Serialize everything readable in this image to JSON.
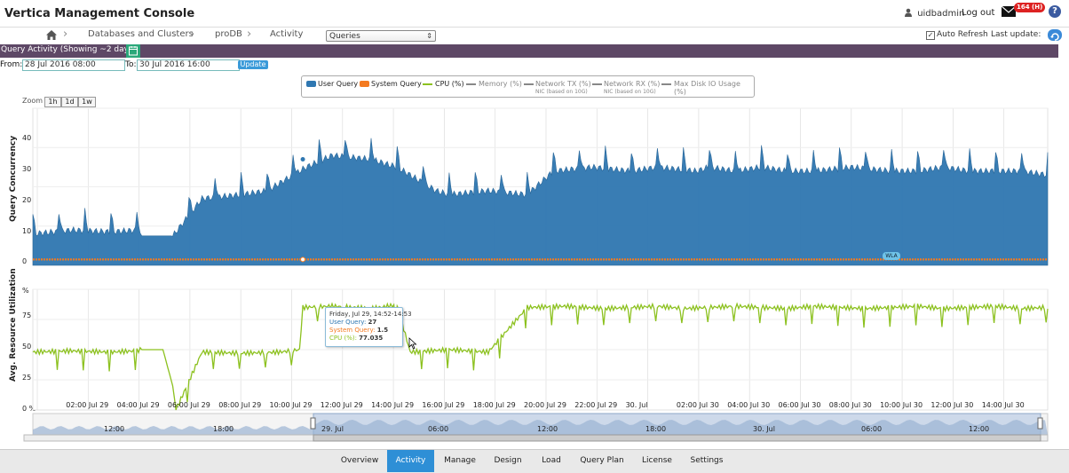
{
  "app": {
    "title": "Vertica Management Console"
  },
  "user": {
    "name": "uidbadmin",
    "logout": "Log out",
    "badge": "164 (H)",
    "help": "?"
  },
  "breadcrumb": {
    "items": [
      "Databases and Clusters",
      "proDB",
      "Activity"
    ]
  },
  "view_select": {
    "value": "Queries"
  },
  "auto_refresh": {
    "label": "Auto Refresh",
    "checked": true,
    "mark": "✓"
  },
  "last_update": {
    "label": "Last update:"
  },
  "panel": {
    "title": "Query Activity  (Showing ~2 days)"
  },
  "range": {
    "from_label": "From:",
    "from_value": "28 Jul 2016 08:00",
    "to_label": "To:",
    "to_value": "30 Jul 2016 16:00",
    "update_label": "Update"
  },
  "zoom": {
    "label": "Zoom",
    "buttons": [
      "1h",
      "1d",
      "1w"
    ]
  },
  "colors": {
    "user_query": "#2f77b1",
    "system_query": "#f47a20",
    "cpu": "#8cc11f",
    "other": "#888888"
  },
  "chart_data": {
    "type": "area",
    "legend": [
      {
        "name": "User Query",
        "sub": ""
      },
      {
        "name": "System Query",
        "sub": ""
      },
      {
        "name": "CPU (%)",
        "sub": ""
      },
      {
        "name": "Memory (%)",
        "sub": ""
      },
      {
        "name": "Network TX (%)",
        "sub": "NIC (based on 10G)"
      },
      {
        "name": "Network RX (%)",
        "sub": "NIC (based on 10G)"
      },
      {
        "name": "Max Disk IO Usage (%)",
        "sub": ""
      }
    ],
    "upper": {
      "ylabel": "Query Concurrency",
      "ylim": [
        0,
        40
      ],
      "yticks": [
        "0",
        "10",
        "20",
        "30",
        "40"
      ],
      "series": [
        {
          "name": "User Query",
          "x": [
            0,
            6,
            12,
            16,
            16.5,
            21.5,
            26,
            32,
            36,
            42,
            46,
            52,
            56,
            62,
            64,
            70,
            76,
            80,
            86,
            92,
            96,
            102,
            104,
            108,
            112,
            116,
            120,
            126,
            132,
            136,
            140,
            144,
            148,
            152,
            156
          ],
          "values": [
            8,
            9,
            8.5,
            9,
            7.5,
            7.5,
            17,
            18,
            19,
            25,
            28,
            27,
            25,
            19,
            18,
            19,
            18,
            24,
            25,
            24,
            25,
            24,
            25,
            24,
            25,
            24,
            24,
            25,
            24,
            24,
            25,
            24,
            24,
            24,
            23
          ]
        },
        {
          "name": "System Query",
          "x": [
            0,
            156
          ],
          "values": [
            1.5,
            1.5
          ]
        }
      ]
    },
    "lower": {
      "ylabel": "Avg. Resource Utilization",
      "ylim": [
        0,
        100
      ],
      "yticks": [
        "0 %",
        "25 %",
        "50 %",
        "75 %",
        "%"
      ],
      "series": [
        {
          "name": "CPU (%)",
          "x": [
            0,
            6,
            12,
            16,
            16.5,
            20,
            21.5,
            22,
            26,
            32,
            38,
            41,
            41.5,
            46,
            52,
            56,
            58,
            64,
            70,
            76,
            82,
            88,
            92,
            96,
            100,
            104,
            108,
            112,
            116,
            120,
            124,
            128,
            132,
            136,
            140,
            144,
            148,
            152,
            156
          ],
          "values": [
            48,
            49,
            48,
            49,
            50,
            50,
            20,
            0,
            48,
            47,
            48,
            50,
            85,
            86,
            84,
            87,
            48,
            50,
            48,
            85,
            86,
            84,
            85,
            86,
            84,
            85,
            86,
            85,
            84,
            86,
            85,
            84,
            85,
            86,
            84,
            85,
            86,
            84,
            85
          ]
        }
      ]
    },
    "xticks": [
      "02:00 Jul 29",
      "04:00 Jul 29",
      "06:00 Jul 29",
      "08:00 Jul 29",
      "10:00 Jul 29",
      "12:00 Jul 29",
      "14:00 Jul 29",
      "16:00 Jul 29",
      "18:00 Jul 29",
      "20:00 Jul 29",
      "22:00 Jul 29",
      "30. Jul",
      "02:00 Jul 30",
      "04:00 Jul 30",
      "06:00 Jul 30",
      "08:00 Jul 30",
      "10:00 Jul 30",
      "12:00 Jul 30",
      "14:00 Jul 30"
    ],
    "navigator_ticks": [
      "12:00",
      "18:00",
      "29. Jul",
      "06:00",
      "12:00",
      "18:00",
      "30. Jul",
      "06:00",
      "12:00"
    ],
    "grid": true,
    "tooltip": {
      "title": "Friday, Jul 29, 14:52-14:53",
      "rows": [
        {
          "label": "User Query:",
          "value": "27"
        },
        {
          "label": "System Query:",
          "value": "1.5"
        },
        {
          "label": "CPU (%):",
          "value": "77.035"
        }
      ]
    },
    "annotation": "WLA"
  },
  "tabs": {
    "items": [
      "Overview",
      "Activity",
      "Manage",
      "Design",
      "Load",
      "Query Plan",
      "License",
      "Settings"
    ],
    "active": "Activity"
  }
}
